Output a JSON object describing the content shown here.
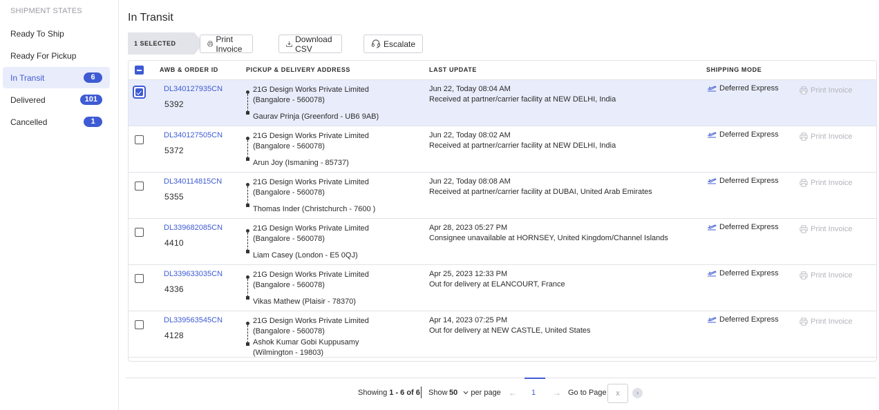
{
  "sidebar": {
    "heading": "SHIPMENT STATES",
    "items": [
      {
        "label": "Ready To Ship",
        "count": null
      },
      {
        "label": "Ready For Pickup",
        "count": null
      },
      {
        "label": "In Transit",
        "count": "6",
        "active": true
      },
      {
        "label": "Delivered",
        "count": "101"
      },
      {
        "label": "Cancelled",
        "count": "1"
      }
    ]
  },
  "main": {
    "title": "In Transit",
    "toolbar": {
      "selected": "1 SELECTED",
      "print_invoice": "Print Invoice",
      "download_csv": "Download CSV",
      "escalate": "Escalate"
    },
    "table": {
      "headers": {
        "awb": "AWB & ORDER ID",
        "address": "PICKUP & DELIVERY ADDRESS",
        "last_update": "LAST UPDATE",
        "shipping_mode": "SHIPPING MODE"
      },
      "rows": [
        {
          "awb": "DL340127935CN",
          "order_id": "5392",
          "pickup": "21G Design Works Private Limited (Bangalore - 560078)",
          "delivery": "Gaurav Prinja (Greenford - UB6 9AB)",
          "update_time": "Jun 22, Today 08:04 AM",
          "update_text": "Received at partner/carrier facility at NEW DELHI, India",
          "mode": "Deferred Express",
          "action": "Print Invoice",
          "selected": true
        },
        {
          "awb": "DL340127505CN",
          "order_id": "5372",
          "pickup": "21G Design Works Private Limited (Bangalore - 560078)",
          "delivery": "Arun Joy (Ismaning - 85737)",
          "update_time": "Jun 22, Today 08:02 AM",
          "update_text": "Received at partner/carrier facility at NEW DELHI, India",
          "mode": "Deferred Express",
          "action": "Print Invoice",
          "selected": false
        },
        {
          "awb": "DL340114815CN",
          "order_id": "5355",
          "pickup": "21G Design Works Private Limited (Bangalore - 560078)",
          "delivery": "Thomas Inder (Christchurch - 7600 )",
          "update_time": "Jun 22, Today 08:08 AM",
          "update_text": "Received at partner/carrier facility at DUBAI, United Arab Emirates",
          "mode": "Deferred Express",
          "action": "Print Invoice",
          "selected": false
        },
        {
          "awb": "DL339682085CN",
          "order_id": "4410",
          "pickup": "21G Design Works Private Limited (Bangalore - 560078)",
          "delivery": "Liam Casey (London - E5 0QJ)",
          "update_time": "Apr 28, 2023 05:27 PM",
          "update_text": "Consignee unavailable at HORNSEY, United Kingdom/Channel Islands",
          "mode": "Deferred Express",
          "action": "Print Invoice",
          "selected": false
        },
        {
          "awb": "DL339633035CN",
          "order_id": "4336",
          "pickup": "21G Design Works Private Limited (Bangalore - 560078)",
          "delivery": "Vikas Mathew (Plaisir - 78370)",
          "update_time": "Apr 25, 2023 12:33 PM",
          "update_text": "Out for delivery at ELANCOURT, France",
          "mode": "Deferred Express",
          "action": "Print Invoice",
          "selected": false
        },
        {
          "awb": "DL339563545CN",
          "order_id": "4128",
          "pickup": "21G Design Works Private Limited (Bangalore - 560078)",
          "delivery": "Ashok Kumar Gobi Kuppusamy (Wilmington - 19803)",
          "update_time": "Apr 14, 2023 07:25 PM",
          "update_text": "Out for delivery at NEW CASTLE, United States",
          "mode": "Deferred Express",
          "action": "Print Invoice",
          "selected": false
        }
      ]
    },
    "pagination": {
      "showing_prefix": "Showing",
      "showing_range": "1 - 6 of 6",
      "show_label": "Show",
      "per_page_value": "50",
      "per_page_suffix": "per page",
      "current_page": "1",
      "goto_label": "Go to Page",
      "goto_placeholder": "x"
    }
  },
  "colors": {
    "accent": "#3e5bd3",
    "selected_row": "#e9edfb",
    "border": "#e1e2e8",
    "muted": "#b4b4bb"
  },
  "icons": {
    "print": "printer-icon",
    "download": "download-icon",
    "escalate": "headset-icon",
    "mode": "plane-icon"
  }
}
